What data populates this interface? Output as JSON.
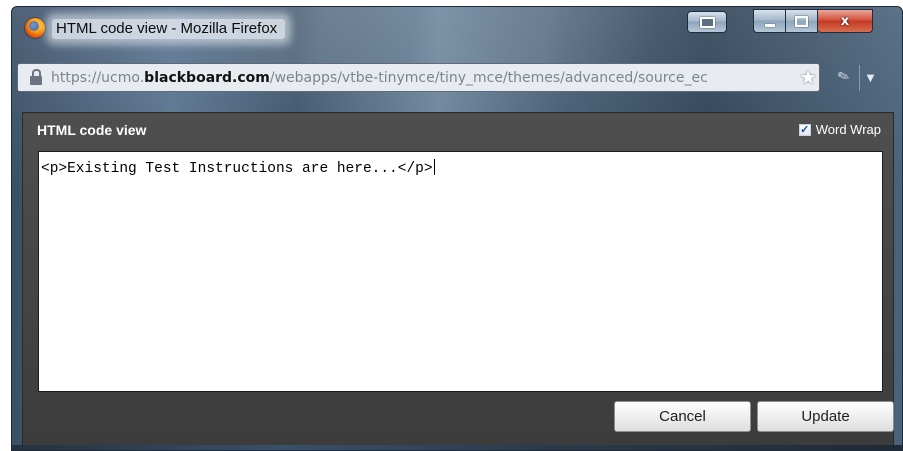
{
  "window": {
    "title": "HTML code view - Mozilla Firefox",
    "url_prefix": "https://ucmo.",
    "url_domain": "blackboard.com",
    "url_path": "/webapps/vtbe-tinymce/tiny_mce/themes/advanced/source_ec",
    "caption_buttons": {
      "minimize": "",
      "maximize": "",
      "close": "x"
    },
    "icons": [
      "firefox-icon",
      "lock-icon",
      "star-icon",
      "puzzle-icon",
      "menu-dropdown-icon"
    ]
  },
  "dialog": {
    "title": "HTML code view",
    "word_wrap_label": "Word Wrap",
    "word_wrap_checked": "✓",
    "code": "<p>Existing Test Instructions are here...</p>",
    "cancel_label": "Cancel",
    "update_label": "Update"
  },
  "colors": {
    "dialog_bg": "#474747",
    "editor_bg": "#ffffff",
    "button_bg": "#f0f0f0",
    "close_button": "#c9452c"
  }
}
